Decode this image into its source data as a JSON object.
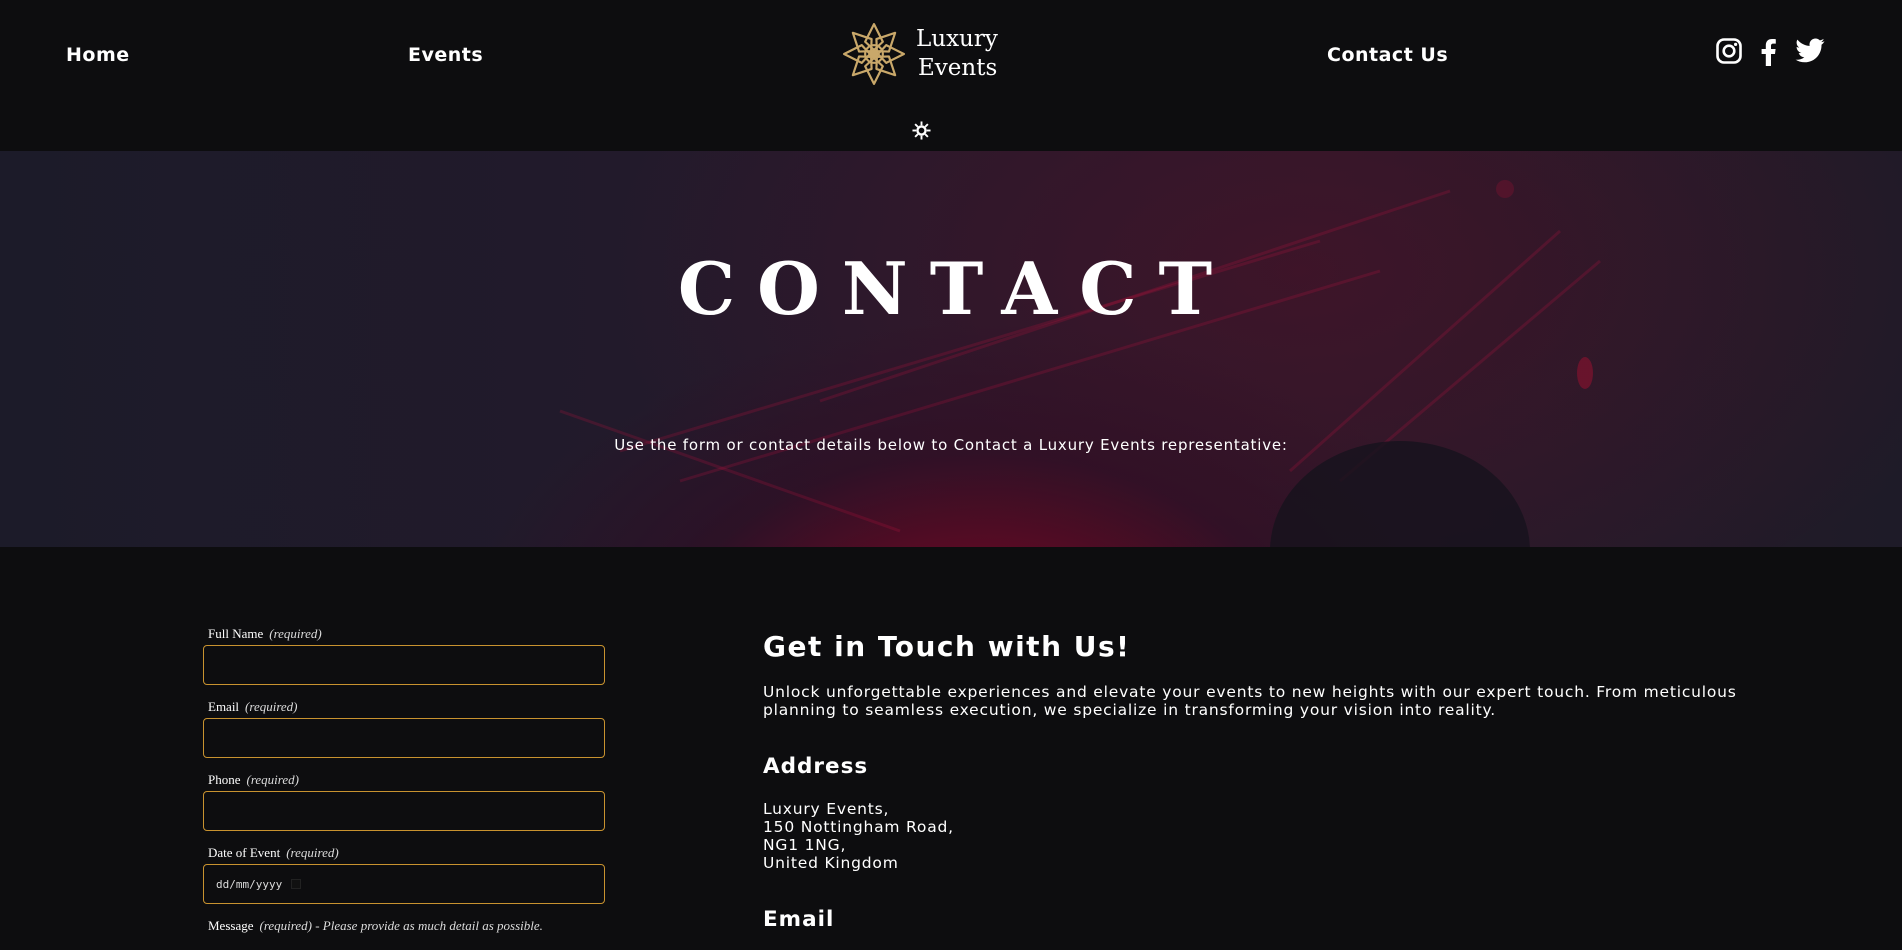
{
  "nav": {
    "home": "Home",
    "events": "Events",
    "contact": "Contact Us"
  },
  "logo": {
    "line1": "Luxury",
    "line2": "Events",
    "color": "#c9a86a"
  },
  "social": [
    "instagram-icon",
    "facebook-icon",
    "twitter-icon"
  ],
  "hero": {
    "title": "CONTACT",
    "subtitle": "Use the form or contact details below to Contact a Luxury Events representative:"
  },
  "form": {
    "full_name": {
      "label": "Full Name",
      "required": "(required)"
    },
    "email": {
      "label": "Email",
      "required": "(required)"
    },
    "phone": {
      "label": "Phone",
      "required": "(required)"
    },
    "date": {
      "label": "Date of Event",
      "required": "(required)",
      "placeholder": "dd/mm/yyyy"
    },
    "message": {
      "label": "Message",
      "required": "(required)",
      "hint": " - Please provide as much detail as possible."
    },
    "border_color": "#c8922f"
  },
  "info": {
    "title": "Get in Touch with Us!",
    "text": "Unlock unforgettable experiences and elevate your events to new heights with our expert touch. From meticulous planning to seamless execution, we specialize in transforming your vision into reality.",
    "address_heading": "Address",
    "address": [
      "Luxury Events,",
      "150 Nottingham Road,",
      "NG1 1NG,",
      "United Kingdom"
    ],
    "email_heading": "Email"
  }
}
